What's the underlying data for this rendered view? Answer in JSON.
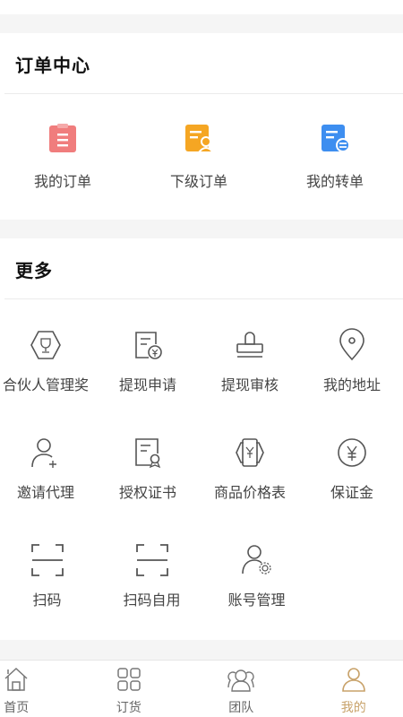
{
  "order_center": {
    "title": "订单中心",
    "items": [
      {
        "label": "我的订单",
        "icon": "clipboard-icon",
        "color": "#f07d7d"
      },
      {
        "label": "下级订单",
        "icon": "subordinate-order-icon",
        "color": "#f5a623"
      },
      {
        "label": "我的转单",
        "icon": "transfer-order-icon",
        "color": "#3d8ef0"
      }
    ]
  },
  "more": {
    "title": "更多",
    "items": [
      {
        "label": "合伙人管理奖",
        "icon": "trophy-hexagon-icon"
      },
      {
        "label": "提现申请",
        "icon": "withdraw-apply-icon"
      },
      {
        "label": "提现审核",
        "icon": "stamp-icon"
      },
      {
        "label": "我的地址",
        "icon": "location-pin-icon"
      },
      {
        "label": "邀请代理",
        "icon": "add-user-icon"
      },
      {
        "label": "授权证书",
        "icon": "certificate-icon"
      },
      {
        "label": "商品价格表",
        "icon": "price-list-icon"
      },
      {
        "label": "保证金",
        "icon": "yuan-coin-icon"
      },
      {
        "label": "扫码",
        "icon": "scan-icon"
      },
      {
        "label": "扫码自用",
        "icon": "scan-self-icon"
      },
      {
        "label": "账号管理",
        "icon": "user-settings-icon"
      }
    ]
  },
  "tabbar": {
    "tabs": [
      {
        "label": "首页",
        "icon": "home-icon"
      },
      {
        "label": "订货",
        "icon": "grid-icon"
      },
      {
        "label": "团队",
        "icon": "team-icon"
      },
      {
        "label": "我的",
        "icon": "profile-icon",
        "active": true
      }
    ],
    "active_color": "#c8a26a"
  }
}
